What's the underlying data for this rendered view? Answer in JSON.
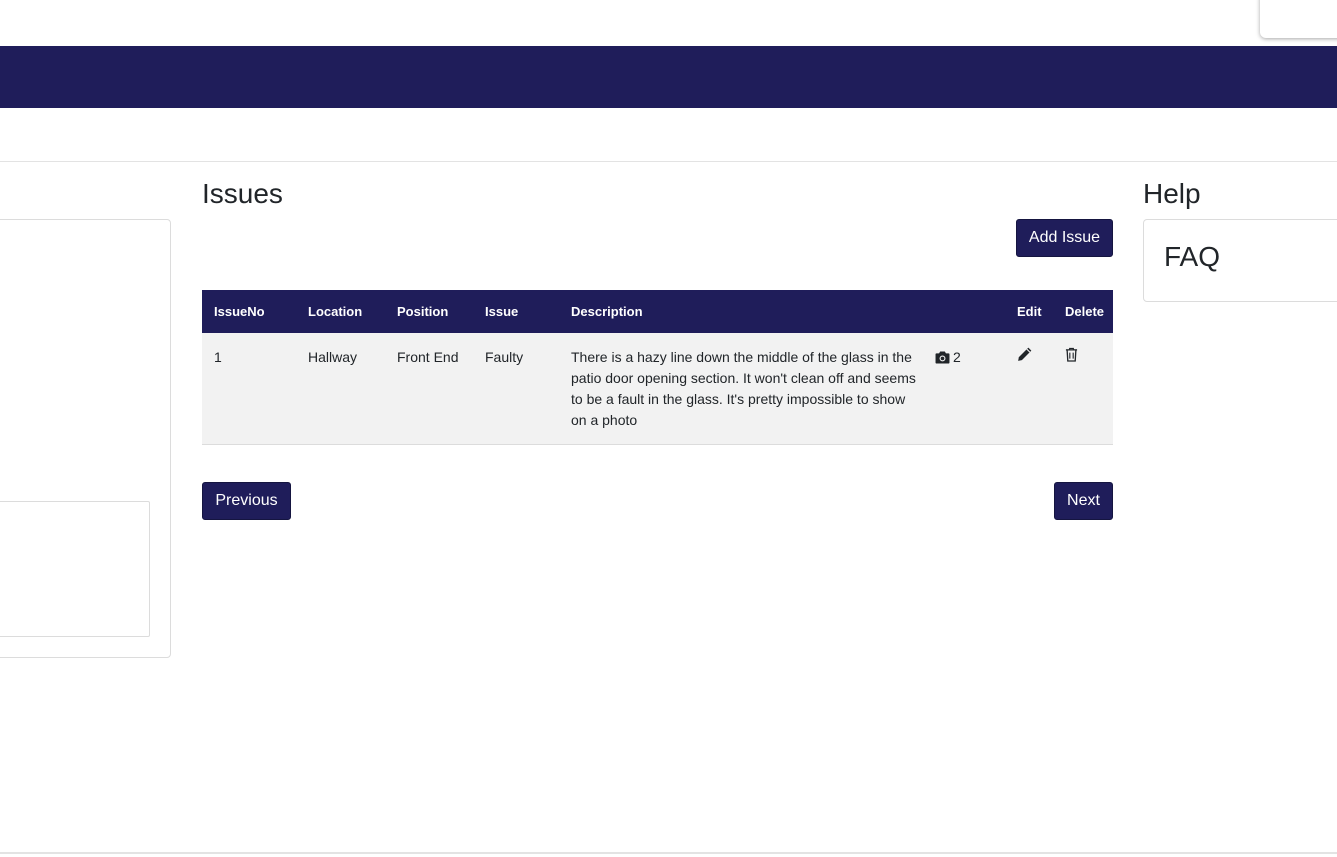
{
  "colors": {
    "brand_navy": "#1f1d5a",
    "row_background": "#f2f2f2",
    "border": "#dcdcdc"
  },
  "issues": {
    "title": "Issues",
    "add_button_label": "Add Issue",
    "columns": [
      "IssueNo",
      "Location",
      "Position",
      "Issue",
      "Description",
      "",
      "Edit",
      "Delete"
    ],
    "rows": [
      {
        "issue_no": "1",
        "location": "Hallway",
        "position": "Front End",
        "issue": "Faulty",
        "description": "There is a hazy line down the middle of the glass in the patio door opening section. It won't clean off and seems to be a fault in the glass. It's pretty impossible to show on a photo",
        "photo_count": "2",
        "photo_icon": "camera-icon",
        "edit_icon": "pencil-icon",
        "delete_icon": "trash-icon"
      }
    ],
    "previous_label": "Previous",
    "next_label": "Next"
  },
  "help": {
    "title": "Help",
    "faq_title": "FAQ"
  }
}
